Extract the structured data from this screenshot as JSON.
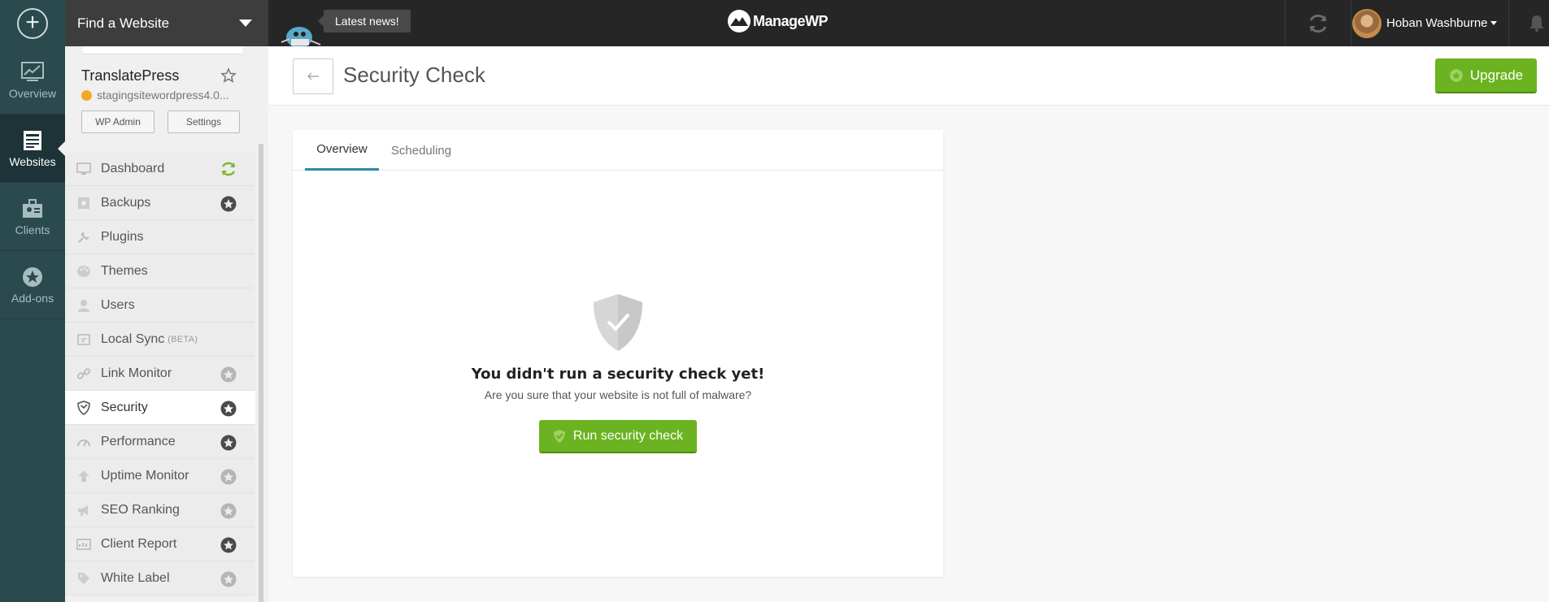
{
  "topbar": {
    "find_website": "Find a Website",
    "news": "Latest news!",
    "logo_text": "ManageWP",
    "user_name": "Hoban Washburne"
  },
  "rail": {
    "items": [
      {
        "label": "Overview",
        "icon": "chart-icon"
      },
      {
        "label": "Websites",
        "icon": "websites-icon",
        "active": true
      },
      {
        "label": "Clients",
        "icon": "clients-icon"
      },
      {
        "label": "Add-ons",
        "icon": "addons-icon"
      }
    ]
  },
  "site": {
    "name": "TranslatePress",
    "url": "stagingsitewordpress4.0...",
    "wp_admin_label": "WP Admin",
    "settings_label": "Settings"
  },
  "menu": {
    "items": [
      {
        "label": "Dashboard",
        "icon": "monitor-icon",
        "right": "sync-icon"
      },
      {
        "label": "Backups",
        "icon": "backup-icon",
        "right": "gear-icon"
      },
      {
        "label": "Plugins",
        "icon": "plug-icon"
      },
      {
        "label": "Themes",
        "icon": "palette-icon"
      },
      {
        "label": "Users",
        "icon": "user-icon"
      },
      {
        "label": "Local Sync",
        "badge": "(BETA)",
        "icon": "local-sync-icon"
      },
      {
        "label": "Link Monitor",
        "icon": "link-icon",
        "right": "gear-icon-faded"
      },
      {
        "label": "Security",
        "icon": "shield-icon",
        "right": "gear-icon",
        "active": true
      },
      {
        "label": "Performance",
        "icon": "speedometer-icon",
        "right": "gear-icon"
      },
      {
        "label": "Uptime Monitor",
        "icon": "arrow-up-icon",
        "right": "gear-icon-faded"
      },
      {
        "label": "SEO Ranking",
        "icon": "megaphone-icon",
        "right": "gear-icon-faded"
      },
      {
        "label": "Client Report",
        "icon": "report-icon",
        "right": "gear-icon"
      },
      {
        "label": "White Label",
        "icon": "tag-icon",
        "right": "gear-icon-faded"
      }
    ]
  },
  "header": {
    "title": "Security Check",
    "upgrade_label": "Upgrade"
  },
  "card": {
    "tabs": [
      "Overview",
      "Scheduling"
    ],
    "active_tab": "Overview",
    "empty_title": "You didn't run a security check yet!",
    "empty_subtitle": "Are you sure that your website is not full of malware?",
    "run_label": "Run security check"
  },
  "colors": {
    "rail_bg": "#2b4a4e",
    "topbar_bg": "#262626",
    "accent_green": "#6bb320",
    "tab_underline": "#2a8aa0"
  }
}
